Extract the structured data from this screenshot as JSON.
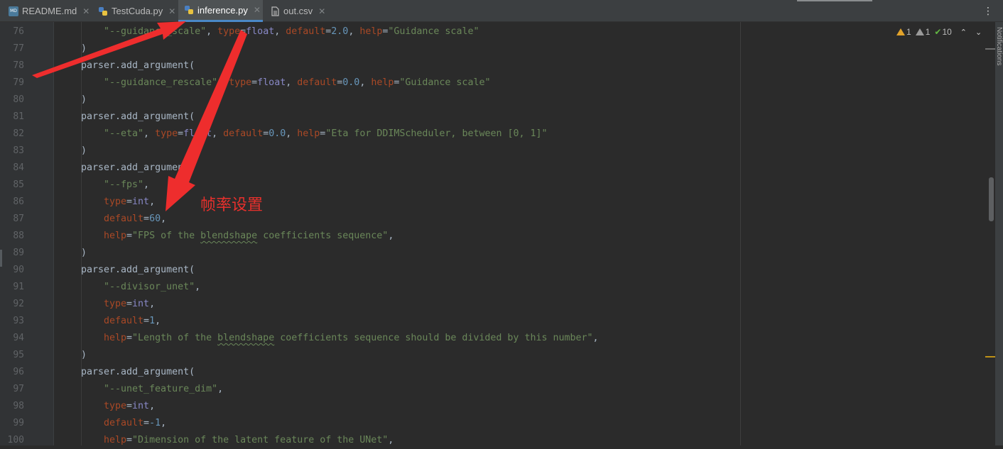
{
  "tabs": [
    {
      "label": "README.md",
      "icon": "markdown-file-icon"
    },
    {
      "label": "TestCuda.py",
      "icon": "python-file-icon"
    },
    {
      "label": "inference.py",
      "icon": "python-file-icon",
      "active": true
    },
    {
      "label": "out.csv",
      "icon": "csv-file-icon"
    }
  ],
  "tab_close_glyph": "✕",
  "tab_menu_glyph": "⋮",
  "inspection": {
    "warnings": "1",
    "weak_warnings": "1",
    "typos": "10"
  },
  "notifications_label": "Notifications",
  "annotation_text": "帧率设置",
  "colors": {
    "accent": "#4a88c7",
    "annotation": "#e8302c",
    "string": "#6a8759",
    "keyword_arg": "#aa4926",
    "number": "#6897bb",
    "builtin": "#8888c6"
  },
  "editor": {
    "line_numbers": [
      "76",
      "77",
      "78",
      "79",
      "80",
      "81",
      "82",
      "83",
      "84",
      "85",
      "86",
      "87",
      "88",
      "89",
      "90",
      "91",
      "92",
      "93",
      "94",
      "95",
      "96",
      "97",
      "98",
      "99",
      "100"
    ],
    "lines": [
      {
        "s1": "\"--guidance_scale\"",
        "t1": ", ",
        "k1": "type",
        "t2": "=",
        "b1": "float",
        "t3": ", ",
        "k2": "default",
        "t4": "=",
        "n1": "2.0",
        "t5": ", ",
        "k3": "help",
        "t6": "=",
        "s2": "\"Guidance scale\""
      },
      {
        "text": ")"
      },
      {
        "text": "parser.add_argument("
      },
      {
        "s1": "\"--guidance_rescale\"",
        "t1": ", ",
        "k1": "type",
        "t2": "=",
        "b1": "float",
        "t3": ", ",
        "k2": "default",
        "t4": "=",
        "n1": "0.0",
        "t5": ", ",
        "k3": "help",
        "t6": "=",
        "s2": "\"Guidance scale\""
      },
      {
        "text": ")"
      },
      {
        "text": "parser.add_argument("
      },
      {
        "s1": "\"--eta\"",
        "t1": ", ",
        "k1": "type",
        "t2": "=",
        "b1": "float",
        "t3": ", ",
        "k2": "default",
        "t4": "=",
        "n1": "0.0",
        "t5": ", ",
        "k3": "help",
        "t6": "=",
        "s2": "\"Eta for DDIMScheduler, between [0, 1]\""
      },
      {
        "text": ")"
      },
      {
        "text": "parser.add_argument("
      },
      {
        "s1": "\"--fps\"",
        "t1": ","
      },
      {
        "k1": "type",
        "t1": "=",
        "b1": "int",
        "t2": ","
      },
      {
        "k1": "default",
        "t1": "=",
        "n1": "60",
        "t2": ","
      },
      {
        "k1": "help",
        "t1": "=",
        "s1": "\"FPS of the ",
        "s2": "blendshape",
        "s3": " coefficients sequence\"",
        "t2": ","
      },
      {
        "text": ")"
      },
      {
        "text": "parser.add_argument("
      },
      {
        "s1": "\"--divisor_unet\"",
        "t1": ","
      },
      {
        "k1": "type",
        "t1": "=",
        "b1": "int",
        "t2": ","
      },
      {
        "k1": "default",
        "t1": "=",
        "n1": "1",
        "t2": ","
      },
      {
        "k1": "help",
        "t1": "=",
        "s1": "\"Length of the ",
        "s2": "blendshape",
        "s3": " coefficients sequence should be divided by this number\"",
        "t2": ","
      },
      {
        "text": ")"
      },
      {
        "text": "parser.add_argument("
      },
      {
        "s1": "\"--unet_feature_dim\"",
        "t1": ","
      },
      {
        "k1": "type",
        "t1": "=",
        "b1": "int",
        "t2": ","
      },
      {
        "k1": "default",
        "t1": "=",
        "n1": "-1",
        "t2": ","
      },
      {
        "k1": "help",
        "t1": "=",
        "s1": "\"Dimension of the latent feature of the UNet\"",
        "t2": ","
      }
    ]
  }
}
